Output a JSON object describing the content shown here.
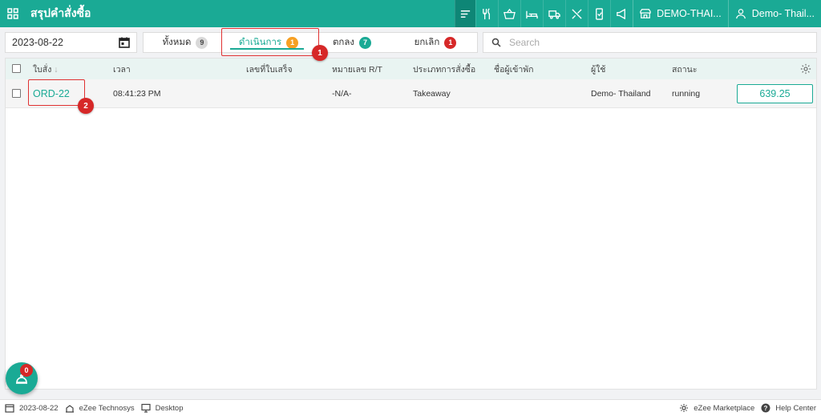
{
  "header": {
    "title": "สรุปคำสั่งซื้อ",
    "branch": "DEMO-THAI...",
    "user": "Demo- Thail...",
    "icons": [
      "menu-lines-icon",
      "utensils-icon",
      "basket-icon",
      "bed-icon",
      "truck-icon",
      "fork-knife-icon",
      "mobile-order-icon",
      "megaphone-icon",
      "store-icon",
      "user-icon"
    ]
  },
  "filters": {
    "date": "2023-08-22",
    "search_placeholder": "Search"
  },
  "tabs": [
    {
      "label": "ทั้งหมด",
      "count": "9",
      "color": "#d9d9d9"
    },
    {
      "label": "ดำเนินการ",
      "count": "1",
      "color": "#f7a023"
    },
    {
      "label": "ตกลง",
      "count": "7",
      "color": "#1aaa95"
    },
    {
      "label": "ยกเลิก",
      "count": "1",
      "color": "#d62828"
    }
  ],
  "table": {
    "columns": [
      "ใบสั่ง",
      "เวลา",
      "เลขที่ใบเสร็จ",
      "หมายเลข R/T",
      "ประเภทการสั่งซื้อ",
      "ชื่อผู้เข้าพัก",
      "ผู้ใช้",
      "สถานะ"
    ],
    "rows": [
      {
        "order": "ORD-22",
        "time": "08:41:23 PM",
        "receipt": "",
        "rt": "-N/A-",
        "type": "Takeaway",
        "guest": "",
        "user": "Demo- Thailand",
        "status": "running",
        "amount": "639.25"
      }
    ]
  },
  "annotations": {
    "marker1": "1",
    "marker2": "2",
    "color": "#e03131"
  },
  "fab": {
    "badge": "0"
  },
  "footer": {
    "date": "2023-08-22",
    "company": "eZee Technosys",
    "device": "Desktop",
    "marketplace": "eZee Marketplace",
    "help": "Help Center"
  },
  "colors": {
    "accent": "#1aaa95",
    "accent_dark": "#0e8676",
    "danger": "#d62828",
    "warning": "#f7a023"
  }
}
